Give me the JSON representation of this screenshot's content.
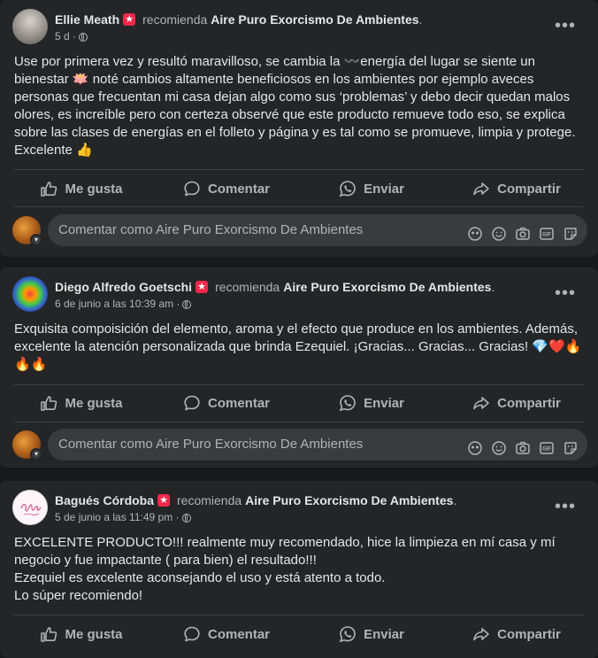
{
  "posts": [
    {
      "author": "Ellie Meath",
      "recommends": "recomienda",
      "page": "Aire Puro Exorcismo De Ambientes",
      "time": "5 d",
      "body": "Use por primera vez y resultó maravilloso, se cambia la 〰️energía del lugar se siente un bienestar 🪷 noté cambios altamente beneficiosos en los ambientes por ejemplo aveces personas que frecuentan mi casa dejan algo como sus ‘problemas’  y debo decir quedan malos olores, es increíble pero con certeza observé que este producto remueve todo eso, se explica sobre las clases de energías en el folleto y página y es tal como se promueve, limpia y protege. Excelente 👍"
    },
    {
      "author": "Diego Alfredo Goetschi",
      "recommends": "recomienda",
      "page": "Aire Puro Exorcismo De Ambientes",
      "time": "6 de junio a las 10:39 am",
      "body": "Exquisita compoisición del elemento, aroma y el efecto que produce en los ambientes. Además, excelente la atención personalizada que brinda Ezequiel. ¡Gracias... Gracias... Gracias! 💎❤️🔥🔥🔥"
    },
    {
      "author": "Bagués Córdoba",
      "recommends": "recomienda",
      "page": "Aire Puro Exorcismo De Ambientes",
      "time": "5 de junio a las 11:49 pm",
      "body": "EXCELENTE PRODUCTO!!! realmente muy recomendado, hice la limpieza en mí casa y mí negocio y fue impactante ( para bien) el resultado!!!\nEzequiel es excelente aconsejando el uso y está atento a todo.\nLo súper recomiendo!"
    }
  ],
  "actions": {
    "like": "Me gusta",
    "comment": "Comentar",
    "send": "Enviar",
    "share": "Compartir"
  },
  "comment_placeholder": "Comentar como Aire Puro Exorcismo De Ambientes",
  "more_glyph": "•••",
  "separator": "·"
}
